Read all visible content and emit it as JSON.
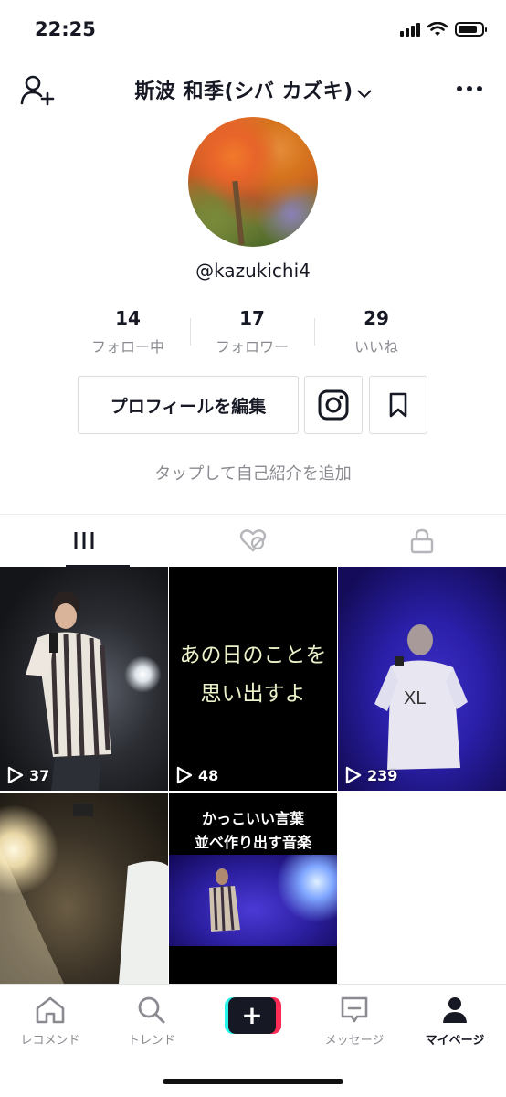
{
  "status_bar": {
    "time": "22:25"
  },
  "header": {
    "title": "斯波 和季(シバ カズキ)",
    "add_user_icon": "add-user-icon",
    "more_icon": "more-icon"
  },
  "profile": {
    "username": "@kazukichi4",
    "stats": [
      {
        "value": "14",
        "label": "フォロー中"
      },
      {
        "value": "17",
        "label": "フォロワー"
      },
      {
        "value": "29",
        "label": "いいね"
      }
    ],
    "edit_button": "プロフィールを編集",
    "bio_placeholder": "タップして自己紹介を追加"
  },
  "tabs": [
    {
      "icon": "grid-icon",
      "active": true
    },
    {
      "icon": "liked-hidden-icon",
      "active": false
    },
    {
      "icon": "lock-icon",
      "active": false
    }
  ],
  "videos": [
    {
      "views": "37"
    },
    {
      "views": "48",
      "caption_lines": [
        "あの日のことを",
        "思い出すよ"
      ]
    },
    {
      "views": "239"
    },
    {
      "views": ""
    },
    {
      "views": "",
      "caption_lines": [
        "かっこいい言葉",
        "並べ作り出す音楽"
      ]
    }
  ],
  "bottom_nav": [
    {
      "label": "レコメンド",
      "icon": "home-icon",
      "active": false
    },
    {
      "label": "トレンド",
      "icon": "search-icon",
      "active": false
    },
    {
      "label": "",
      "icon": "plus-icon",
      "active": false
    },
    {
      "label": "メッセージ",
      "icon": "message-icon",
      "active": false
    },
    {
      "label": "マイページ",
      "icon": "profile-icon",
      "active": true
    }
  ],
  "colors": {
    "accent_cyan": "#25f4ee",
    "accent_red": "#fe2c55",
    "text": "#161823",
    "muted": "#8a8b91"
  }
}
